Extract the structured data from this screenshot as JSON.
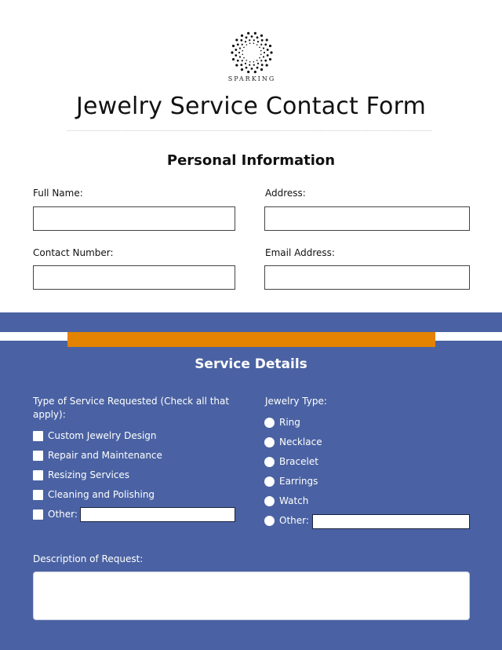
{
  "brand": {
    "name": "SPARKING",
    "logo_icon": "sparkle-dot-circle-icon"
  },
  "title": "Jewelry Service Contact Form",
  "personal": {
    "heading": "Personal Information",
    "fields": [
      {
        "label": "Full Name:",
        "value": ""
      },
      {
        "label": "Address:",
        "value": ""
      },
      {
        "label": "Contact Number:",
        "value": ""
      },
      {
        "label": "Email Address:",
        "value": ""
      }
    ]
  },
  "service": {
    "heading": "Service Details",
    "service_type": {
      "label": "Type of Service Requested (Check all that apply):",
      "options": [
        {
          "label": "Custom Jewelry Design",
          "checked": false
        },
        {
          "label": "Repair and Maintenance",
          "checked": false
        },
        {
          "label": "Resizing Services",
          "checked": false
        },
        {
          "label": "Cleaning and Polishing",
          "checked": false
        },
        {
          "label": "Other:",
          "checked": false
        }
      ],
      "other_value": ""
    },
    "jewelry_type": {
      "label": "Jewelry Type:",
      "options": [
        {
          "label": "Ring",
          "selected": false
        },
        {
          "label": "Necklace",
          "selected": false
        },
        {
          "label": "Bracelet",
          "selected": false
        },
        {
          "label": "Earrings",
          "selected": false
        },
        {
          "label": "Watch",
          "selected": false
        },
        {
          "label": "Other:",
          "selected": false
        }
      ],
      "other_value": ""
    },
    "description": {
      "label": "Description of Request:",
      "value": ""
    }
  },
  "colors": {
    "primary_blue": "#4a62a3",
    "accent_orange": "#e38300",
    "text": "#111111"
  }
}
